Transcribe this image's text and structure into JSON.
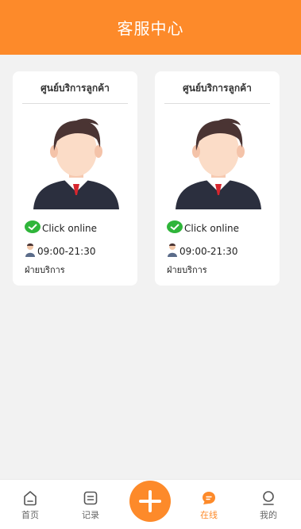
{
  "header": {
    "title": "客服中心"
  },
  "cards": [
    {
      "title": "ศูนย์บริการลูกค้า",
      "online_label": "Click online",
      "hours": "09:00-21:30",
      "department": "ฝ่ายบริการ"
    },
    {
      "title": "ศูนย์บริการลูกค้า",
      "online_label": "Click online",
      "hours": "09:00-21:30",
      "department": "ฝ่ายบริการ"
    }
  ],
  "tabbar": {
    "items": [
      {
        "label": "首页",
        "icon": "home-icon",
        "active": false
      },
      {
        "label": "记录",
        "icon": "record-icon",
        "active": false
      },
      {
        "label": "",
        "icon": "plus-icon",
        "active": false
      },
      {
        "label": "在线",
        "icon": "chat-icon",
        "active": true
      },
      {
        "label": "我的",
        "icon": "user-icon",
        "active": false
      }
    ]
  },
  "colors": {
    "accent": "#fd8a2a",
    "background": "#f2f2f2",
    "online_green": "#2fb53a"
  }
}
